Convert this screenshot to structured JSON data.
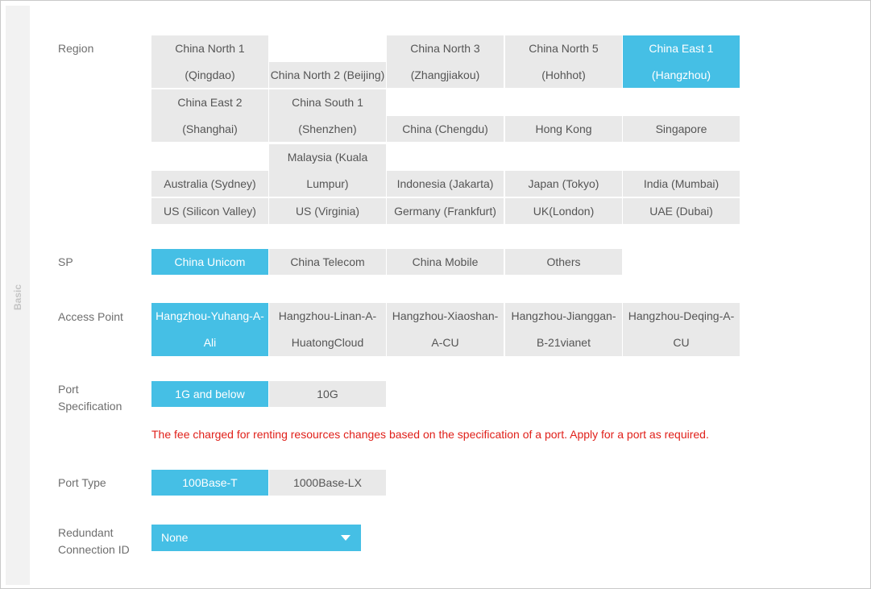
{
  "section_tab": "Basic",
  "labels": {
    "region": "Region",
    "sp": "SP",
    "access_point": "Access Point",
    "port_spec_line1": "Port",
    "port_spec_line2": "Specification",
    "port_type": "Port Type",
    "redundant_line1": "Redundant",
    "redundant_line2": "Connection ID"
  },
  "regions": [
    {
      "lines": [
        "China North 1",
        "(Qingdao)"
      ],
      "selected": false
    },
    {
      "lines": [
        "China North 2 (Beijing)"
      ],
      "selected": false
    },
    {
      "lines": [
        "China North 3",
        "(Zhangjiakou)"
      ],
      "selected": false
    },
    {
      "lines": [
        "China North 5",
        "(Hohhot)"
      ],
      "selected": false
    },
    {
      "lines": [
        "China East 1",
        "(Hangzhou)"
      ],
      "selected": true
    },
    {
      "lines": [
        "China East 2",
        "(Shanghai)"
      ],
      "selected": false
    },
    {
      "lines": [
        "China South 1",
        "(Shenzhen)"
      ],
      "selected": false
    },
    {
      "lines": [
        "China (Chengdu)"
      ],
      "selected": false
    },
    {
      "lines": [
        "Hong Kong"
      ],
      "selected": false
    },
    {
      "lines": [
        "Singapore"
      ],
      "selected": false
    },
    {
      "lines": [
        "Australia (Sydney)"
      ],
      "selected": false
    },
    {
      "lines": [
        "Malaysia (Kuala",
        "Lumpur)"
      ],
      "selected": false
    },
    {
      "lines": [
        "Indonesia (Jakarta)"
      ],
      "selected": false
    },
    {
      "lines": [
        "Japan (Tokyo)"
      ],
      "selected": false
    },
    {
      "lines": [
        "India (Mumbai)"
      ],
      "selected": false
    },
    {
      "lines": [
        "US (Silicon Valley)"
      ],
      "selected": false
    },
    {
      "lines": [
        "US (Virginia)"
      ],
      "selected": false
    },
    {
      "lines": [
        "Germany (Frankfurt)"
      ],
      "selected": false
    },
    {
      "lines": [
        "UK(London)"
      ],
      "selected": false
    },
    {
      "lines": [
        "UAE (Dubai)"
      ],
      "selected": false
    }
  ],
  "sp_options": [
    {
      "lines": [
        "China Unicom"
      ],
      "selected": true
    },
    {
      "lines": [
        "China Telecom"
      ],
      "selected": false
    },
    {
      "lines": [
        "China Mobile"
      ],
      "selected": false
    },
    {
      "lines": [
        "Others"
      ],
      "selected": false
    }
  ],
  "access_points": [
    {
      "lines": [
        "Hangzhou-Yuhang-A-",
        "Ali"
      ],
      "selected": true
    },
    {
      "lines": [
        "Hangzhou-Linan-A-",
        "HuatongCloud"
      ],
      "selected": false
    },
    {
      "lines": [
        "Hangzhou-Xiaoshan-",
        "A-CU"
      ],
      "selected": false
    },
    {
      "lines": [
        "Hangzhou-Jianggan-",
        "B-21vianet"
      ],
      "selected": false
    },
    {
      "lines": [
        "Hangzhou-Deqing-A-",
        "CU"
      ],
      "selected": false
    }
  ],
  "port_specs": [
    {
      "lines": [
        "1G and below"
      ],
      "selected": true
    },
    {
      "lines": [
        "10G"
      ],
      "selected": false
    }
  ],
  "port_note": "The fee charged for renting resources changes based on the specification of a port. Apply for a port as required.",
  "port_types": [
    {
      "lines": [
        "100Base-T"
      ],
      "selected": true
    },
    {
      "lines": [
        "1000Base-LX"
      ],
      "selected": false
    }
  ],
  "redundant_select": {
    "value": "None"
  },
  "colors": {
    "accent": "#45bfe5",
    "option_bg": "#e9e9e9",
    "warning": "#e0201a"
  }
}
